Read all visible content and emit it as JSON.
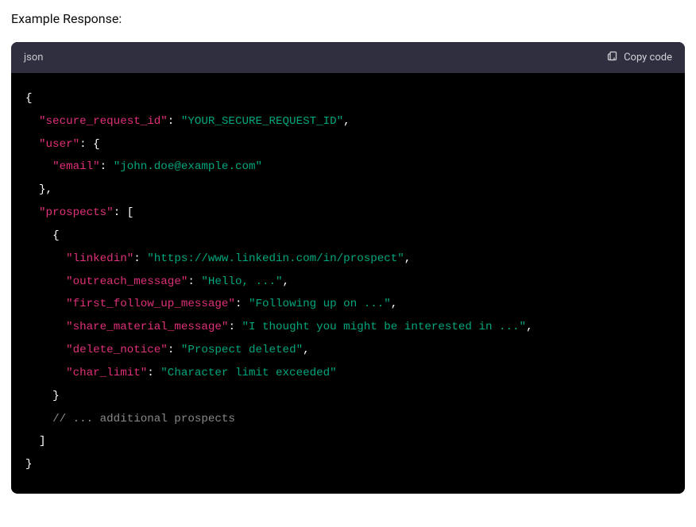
{
  "heading": "Example Response:",
  "codeHeader": {
    "language": "json",
    "copyLabel": "Copy code"
  },
  "code": {
    "l1": "{",
    "k_secure_request_id": "\"secure_request_id\"",
    "v_secure_request_id": "\"YOUR_SECURE_REQUEST_ID\"",
    "k_user": "\"user\"",
    "k_email": "\"email\"",
    "v_email": "\"john.doe@example.com\"",
    "k_prospects": "\"prospects\"",
    "k_linkedin": "\"linkedin\"",
    "v_linkedin": "\"https://www.linkedin.com/in/prospect\"",
    "k_outreach": "\"outreach_message\"",
    "v_outreach": "\"Hello, ...\"",
    "k_first_follow": "\"first_follow_up_message\"",
    "v_first_follow": "\"Following up on ...\"",
    "k_share": "\"share_material_message\"",
    "v_share": "\"I thought you might be interested in ...\"",
    "k_delete": "\"delete_notice\"",
    "v_delete": "\"Prospect deleted\"",
    "k_char": "\"char_limit\"",
    "v_char": "\"Character limit exceeded\"",
    "comment": "// ... additional prospects",
    "colon": ": ",
    "comma": ",",
    "open_brace": "{",
    "close_brace": "}",
    "open_bracket": "[",
    "close_bracket": "]",
    "close_brace_comma": "},"
  }
}
